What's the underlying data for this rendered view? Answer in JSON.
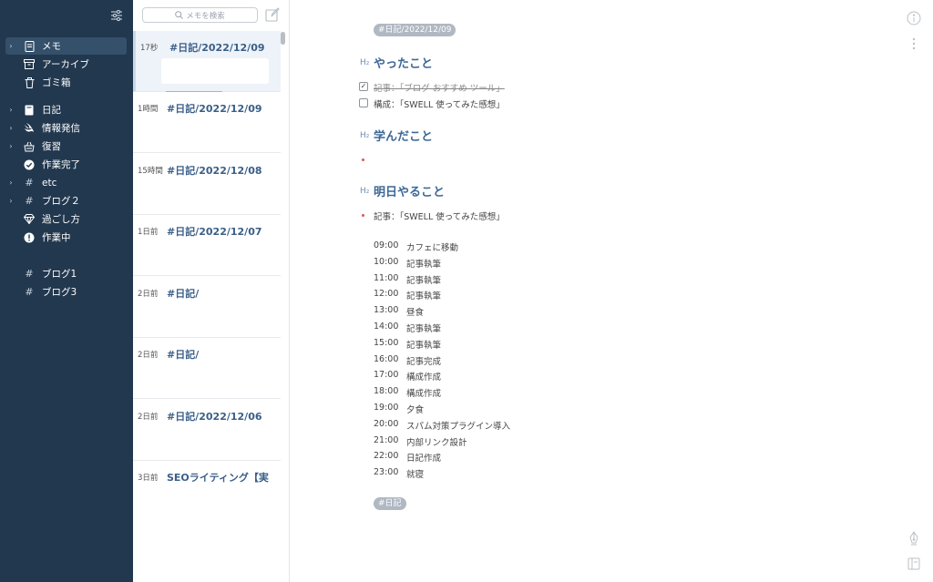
{
  "sidebar": {
    "items": [
      {
        "label": "メモ",
        "icon": "memo-icon",
        "chevron": true,
        "active": true
      },
      {
        "label": "アーカイブ",
        "icon": "archive-icon",
        "chevron": false
      },
      {
        "label": "ゴミ箱",
        "icon": "trash-icon",
        "chevron": false
      },
      {
        "label": "日記",
        "icon": "book-icon",
        "chevron": true
      },
      {
        "label": "情報発信",
        "icon": "swift-icon",
        "chevron": true
      },
      {
        "label": "復習",
        "icon": "basket-icon",
        "chevron": true
      },
      {
        "label": "作業完了",
        "icon": "check-circle-icon",
        "chevron": false
      },
      {
        "label": "etc",
        "icon": "hash-icon",
        "chevron": true
      },
      {
        "label": "ブログ２",
        "icon": "hash-icon",
        "chevron": true
      },
      {
        "label": "過ごし方",
        "icon": "diamond-icon",
        "chevron": false
      },
      {
        "label": "作業中",
        "icon": "alert-circle-icon",
        "chevron": false
      },
      {
        "label": "ブログ1",
        "icon": "hash-icon",
        "chevron": false
      },
      {
        "label": "ブログ3",
        "icon": "hash-icon",
        "chevron": false
      }
    ]
  },
  "list": {
    "search_placeholder": "メモを検索",
    "notes": [
      {
        "time": "17秒",
        "title": "#日記/2022/12/09"
      },
      {
        "time": "1時間",
        "title": "#日記/2022/12/09"
      },
      {
        "time": "15時間",
        "title": "#日記/2022/12/08"
      },
      {
        "time": "1日前",
        "title": "#日記/2022/12/07"
      },
      {
        "time": "2日前",
        "title": "#日記/"
      },
      {
        "time": "2日前",
        "title": "#日記/"
      },
      {
        "time": "2日前",
        "title": "#日記/2022/12/06"
      },
      {
        "time": "3日前",
        "title": "SEOライティング【実"
      }
    ]
  },
  "editor": {
    "top_tag": "#日記/2022/12/09",
    "h2_marker": "H₂",
    "section1": "やったこと",
    "tasks": [
      {
        "text": "記事：「ブログ おすすめ ツール」",
        "checked": true
      },
      {
        "text": "構成：「SWELL 使ってみた感想」",
        "checked": false
      }
    ],
    "section2": "学んだこと",
    "section3": "明日やること",
    "todo_item": "記事：「SWELL 使ってみた感想」",
    "schedule": [
      {
        "time": "09:00",
        "task": "カフェに移動"
      },
      {
        "time": "10:00",
        "task": "記事執筆"
      },
      {
        "time": "11:00",
        "task": "記事執筆"
      },
      {
        "time": "12:00",
        "task": "記事執筆"
      },
      {
        "time": "13:00",
        "task": "昼食"
      },
      {
        "time": "14:00",
        "task": "記事執筆"
      },
      {
        "time": "15:00",
        "task": "記事執筆"
      },
      {
        "time": "16:00",
        "task": "記事完成"
      },
      {
        "time": "17:00",
        "task": "構成作成"
      },
      {
        "time": "18:00",
        "task": "構成作成"
      },
      {
        "time": "19:00",
        "task": "夕食"
      },
      {
        "time": "20:00",
        "task": "スパム対策プラグイン導入"
      },
      {
        "time": "21:00",
        "task": "内部リンク設計"
      },
      {
        "time": "22:00",
        "task": "日記作成"
      },
      {
        "time": "23:00",
        "task": "就寝"
      }
    ],
    "bottom_tag": "#日記"
  },
  "colors": {
    "sidebar_bg": "#22384f",
    "accent_heading": "#3d6896",
    "tag_bg": "#b0b8c2",
    "bullet": "#d45a5a"
  }
}
